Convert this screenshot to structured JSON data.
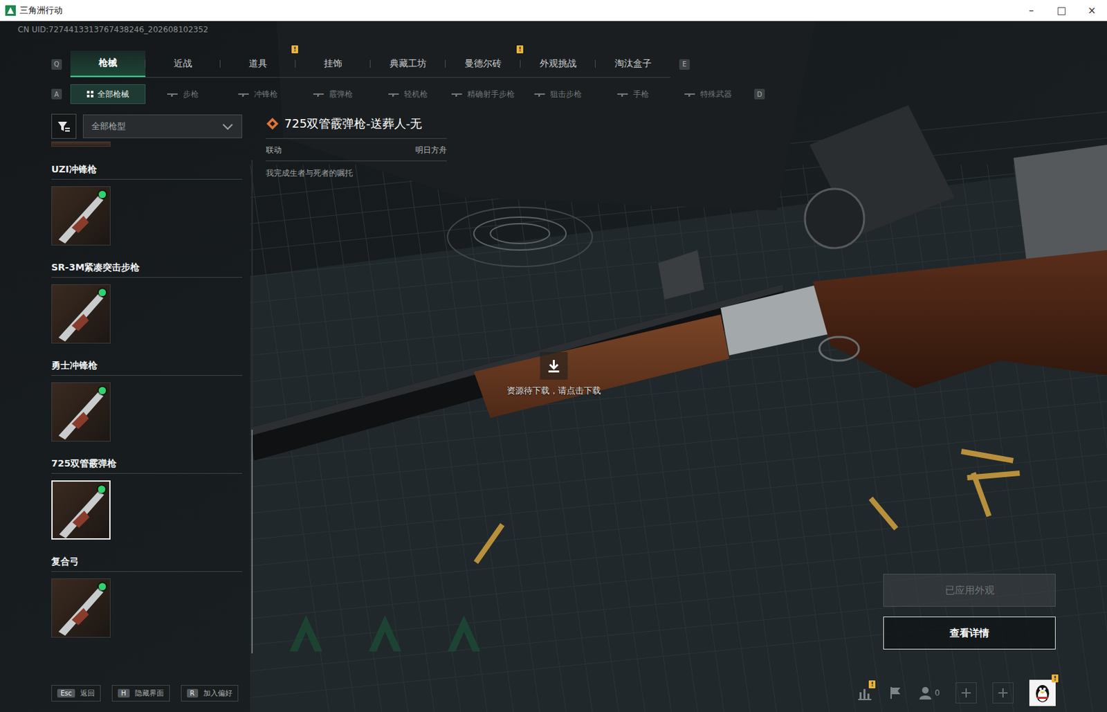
{
  "window": {
    "title": "三角洲行动",
    "controls": [
      "–",
      "□",
      "×"
    ]
  },
  "uid": "CN UID:7274413313767438246_202608102352",
  "top_tabs": {
    "prev_key": "Q",
    "next_key": "E",
    "items": [
      {
        "label": "枪械",
        "selected": true,
        "badge": ""
      },
      {
        "label": "近战",
        "selected": false,
        "badge": ""
      },
      {
        "label": "道具",
        "selected": false,
        "badge": "!"
      },
      {
        "label": "挂饰",
        "selected": false,
        "badge": ""
      },
      {
        "label": "典藏工坊",
        "selected": false,
        "badge": ""
      },
      {
        "label": "曼德尔砖",
        "selected": false,
        "badge": "!"
      },
      {
        "label": "外观挑战",
        "selected": false,
        "badge": ""
      },
      {
        "label": "淘汰盒子",
        "selected": false,
        "badge": ""
      }
    ]
  },
  "sub_tabs": {
    "prev_key": "A",
    "next_key": "D",
    "items": [
      {
        "label": "全部枪械",
        "selected": true
      },
      {
        "label": "步枪",
        "selected": false
      },
      {
        "label": "冲锋枪",
        "selected": false
      },
      {
        "label": "霰弹枪",
        "selected": false
      },
      {
        "label": "轻机枪",
        "selected": false
      },
      {
        "label": "精确射手步枪",
        "selected": false
      },
      {
        "label": "狙击步枪",
        "selected": false
      },
      {
        "label": "手枪",
        "selected": false
      },
      {
        "label": "特殊武器",
        "selected": false
      }
    ]
  },
  "filter": {
    "value": "全部枪型"
  },
  "weapons": [
    {
      "name": "UZI冲锋枪",
      "owned": true,
      "selected": false
    },
    {
      "name": "SR-3M紧凑突击步枪",
      "owned": true,
      "selected": false
    },
    {
      "name": "勇士冲锋枪",
      "owned": true,
      "selected": false
    },
    {
      "name": "725双管霰弹枪",
      "owned": true,
      "selected": true
    },
    {
      "name": "复合弓",
      "owned": true,
      "selected": false
    }
  ],
  "detail": {
    "title": "725双管霰弹枪-送葬人-无",
    "tag_label": "联动",
    "tag_value": "明日方舟",
    "description": "我完成生者与死者的嘱托"
  },
  "download": {
    "text": "资源待下载，请点击下载"
  },
  "actions": [
    {
      "label": "已应用外观",
      "disabled": true
    },
    {
      "label": "查看详情",
      "disabled": false
    }
  ],
  "hotkeys": [
    {
      "key": "Esc",
      "label": "返回"
    },
    {
      "key": "H",
      "label": "隐藏界面"
    },
    {
      "key": "R",
      "label": "加入偏好"
    }
  ],
  "toolbar": {
    "stats_badge": "!",
    "friends_count": "0",
    "avatar_badge": "!"
  }
}
